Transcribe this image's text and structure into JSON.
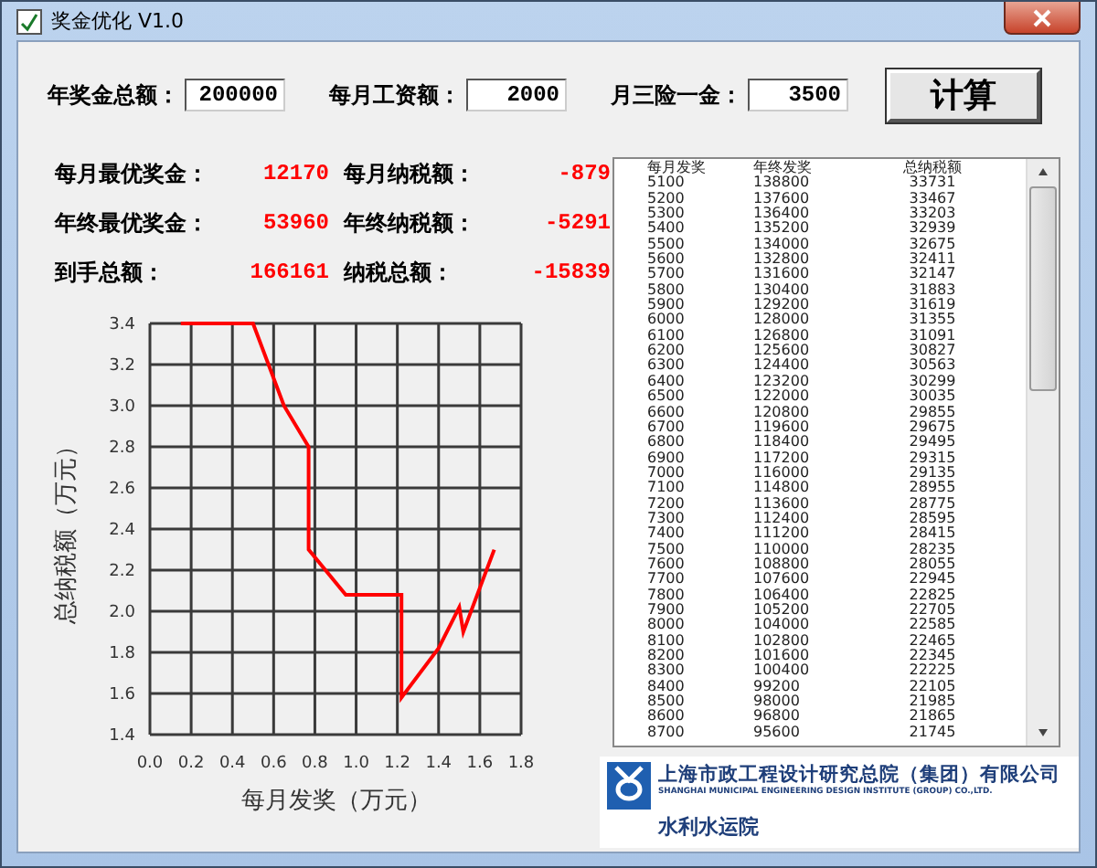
{
  "window": {
    "title": "奖金优化  V1.0"
  },
  "inputs": [
    {
      "label": "年奖金总额：",
      "value": "200000"
    },
    {
      "label": "每月工资额：",
      "value": "2000"
    },
    {
      "label": "月三险一金：",
      "value": "3500"
    }
  ],
  "calculate_button": "计算",
  "results": [
    {
      "label": "每月最优奖金：",
      "value": "12170"
    },
    {
      "label": "每月纳税额：",
      "value": "-879"
    },
    {
      "label": "年终最优奖金：",
      "value": "53960"
    },
    {
      "label": "年终纳税额：",
      "value": "-5291"
    },
    {
      "label": "到手总额：",
      "value": "166161"
    },
    {
      "label": "纳税总额：",
      "value": "-15839"
    }
  ],
  "chart": {
    "chart_data": {
      "type": "line",
      "grid": true,
      "xlabel": "每月发奖（万元）",
      "ylabel": "总纳税额（万元）",
      "x": [
        0.15,
        0.5,
        0.65,
        0.77,
        0.77,
        0.95,
        1.22,
        1.22,
        1.4,
        1.5,
        1.52,
        1.67
      ],
      "series": [
        {
          "color": "#ff0000",
          "values": [
            3.4,
            3.4,
            3.0,
            2.8,
            2.3,
            2.08,
            2.08,
            1.58,
            1.82,
            2.02,
            1.9,
            2.3
          ]
        }
      ],
      "xlim": [
        0,
        1.8
      ],
      "ylim": [
        1.4,
        3.4
      ],
      "xticks": [
        {
          "value": 0,
          "label": "0.0"
        },
        {
          "value": 0.2,
          "label": "0.2"
        },
        {
          "value": 0.4,
          "label": "0.4"
        },
        {
          "value": 0.6,
          "label": "0.6"
        },
        {
          "value": 0.8,
          "label": "0.8"
        },
        {
          "value": 1.0,
          "label": "1.0"
        },
        {
          "value": 1.2,
          "label": "1.2"
        },
        {
          "value": 1.4,
          "label": "1.4"
        },
        {
          "value": 1.6,
          "label": "1.6"
        },
        {
          "value": 1.8,
          "label": "1.8"
        }
      ],
      "yticks": [
        {
          "value": 1.4,
          "label": "1.4"
        },
        {
          "value": 1.6,
          "label": "1.6"
        },
        {
          "value": 1.8,
          "label": "1.8"
        },
        {
          "value": 2.0,
          "label": "2.0"
        },
        {
          "value": 2.2,
          "label": "2.2"
        },
        {
          "value": 2.4,
          "label": "2.4"
        },
        {
          "value": 2.6,
          "label": "2.6"
        },
        {
          "value": 2.8,
          "label": "2.8"
        },
        {
          "value": 3.0,
          "label": "3.0"
        },
        {
          "value": 3.2,
          "label": "3.2"
        },
        {
          "value": 3.4,
          "label": "3.4"
        }
      ]
    }
  },
  "table": {
    "columns": [
      "每月发奖",
      "年终发奖",
      "总纳税额"
    ],
    "rows": [
      [
        "5100",
        "138800",
        "33731"
      ],
      [
        "5200",
        "137600",
        "33467"
      ],
      [
        "5300",
        "136400",
        "33203"
      ],
      [
        "5400",
        "135200",
        "32939"
      ],
      [
        "5500",
        "134000",
        "32675"
      ],
      [
        "5600",
        "132800",
        "32411"
      ],
      [
        "5700",
        "131600",
        "32147"
      ],
      [
        "5800",
        "130400",
        "31883"
      ],
      [
        "5900",
        "129200",
        "31619"
      ],
      [
        "6000",
        "128000",
        "31355"
      ],
      [
        "6100",
        "126800",
        "31091"
      ],
      [
        "6200",
        "125600",
        "30827"
      ],
      [
        "6300",
        "124400",
        "30563"
      ],
      [
        "6400",
        "123200",
        "30299"
      ],
      [
        "6500",
        "122000",
        "30035"
      ],
      [
        "6600",
        "120800",
        "29855"
      ],
      [
        "6700",
        "119600",
        "29675"
      ],
      [
        "6800",
        "118400",
        "29495"
      ],
      [
        "6900",
        "117200",
        "29315"
      ],
      [
        "7000",
        "116000",
        "29135"
      ],
      [
        "7100",
        "114800",
        "28955"
      ],
      [
        "7200",
        "113600",
        "28775"
      ],
      [
        "7300",
        "112400",
        "28595"
      ],
      [
        "7400",
        "111200",
        "28415"
      ],
      [
        "7500",
        "110000",
        "28235"
      ],
      [
        "7600",
        "108800",
        "28055"
      ],
      [
        "7700",
        "107600",
        "22945"
      ],
      [
        "7800",
        "106400",
        "22825"
      ],
      [
        "7900",
        "105200",
        "22705"
      ],
      [
        "8000",
        "104000",
        "22585"
      ],
      [
        "8100",
        "102800",
        "22465"
      ],
      [
        "8200",
        "101600",
        "22345"
      ],
      [
        "8300",
        "100400",
        "22225"
      ],
      [
        "8400",
        "99200",
        "22105"
      ],
      [
        "8500",
        "98000",
        "21985"
      ],
      [
        "8600",
        "96800",
        "21865"
      ],
      [
        "8700",
        "95600",
        "21745"
      ]
    ]
  },
  "logo": {
    "name": "上海市政工程设计研究总院（集团）有限公司",
    "name_en": "SHANGHAI MUNICIPAL ENGINEERING DESIGN INSTITUTE (GROUP) CO.,LTD.",
    "department": "水利水运院"
  }
}
